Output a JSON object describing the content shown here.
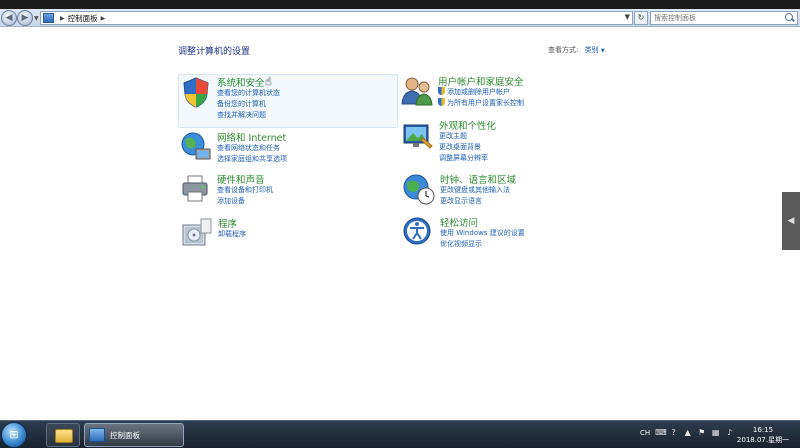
{
  "window": {
    "breadcrumb": "控制面板",
    "search_placeholder": "搜索控制面板"
  },
  "header": {
    "title": "调整计算机的设置",
    "view_by_label": "查看方式:",
    "view_by_value": "类别"
  },
  "categories": [
    {
      "title": "系统和安全",
      "icon": "shield-icon",
      "links": [
        "查看您的计算机状态",
        "备份您的计算机",
        "查找并解决问题"
      ]
    },
    {
      "title": "网络和 Internet",
      "icon": "network-icon",
      "links": [
        "查看网络状态和任务",
        "选择家庭组和共享选项"
      ]
    },
    {
      "title": "硬件和声音",
      "icon": "printer-icon",
      "links": [
        "查看设备和打印机",
        "添加设备"
      ]
    },
    {
      "title": "程序",
      "icon": "programs-icon",
      "links": [
        "卸载程序"
      ]
    },
    {
      "title": "用户帐户和家庭安全",
      "icon": "users-icon",
      "links": [
        "添加或删除用户帐户",
        "为所有用户设置家长控制"
      ]
    },
    {
      "title": "外观和个性化",
      "icon": "appearance-icon",
      "links": [
        "更改主题",
        "更改桌面背景",
        "调整屏幕分辨率"
      ]
    },
    {
      "title": "时钟、语言和区域",
      "icon": "globe-clock-icon",
      "links": [
        "更改键盘或其他输入法",
        "更改显示语言"
      ]
    },
    {
      "title": "轻松访问",
      "icon": "ease-of-access-icon",
      "links": [
        "使用 Windows 建议的设置",
        "优化视频显示"
      ]
    }
  ],
  "taskbar": {
    "active_window": "控制面板",
    "tray_language": "CH",
    "time": "16:15",
    "date": "2018.07.星期一"
  }
}
